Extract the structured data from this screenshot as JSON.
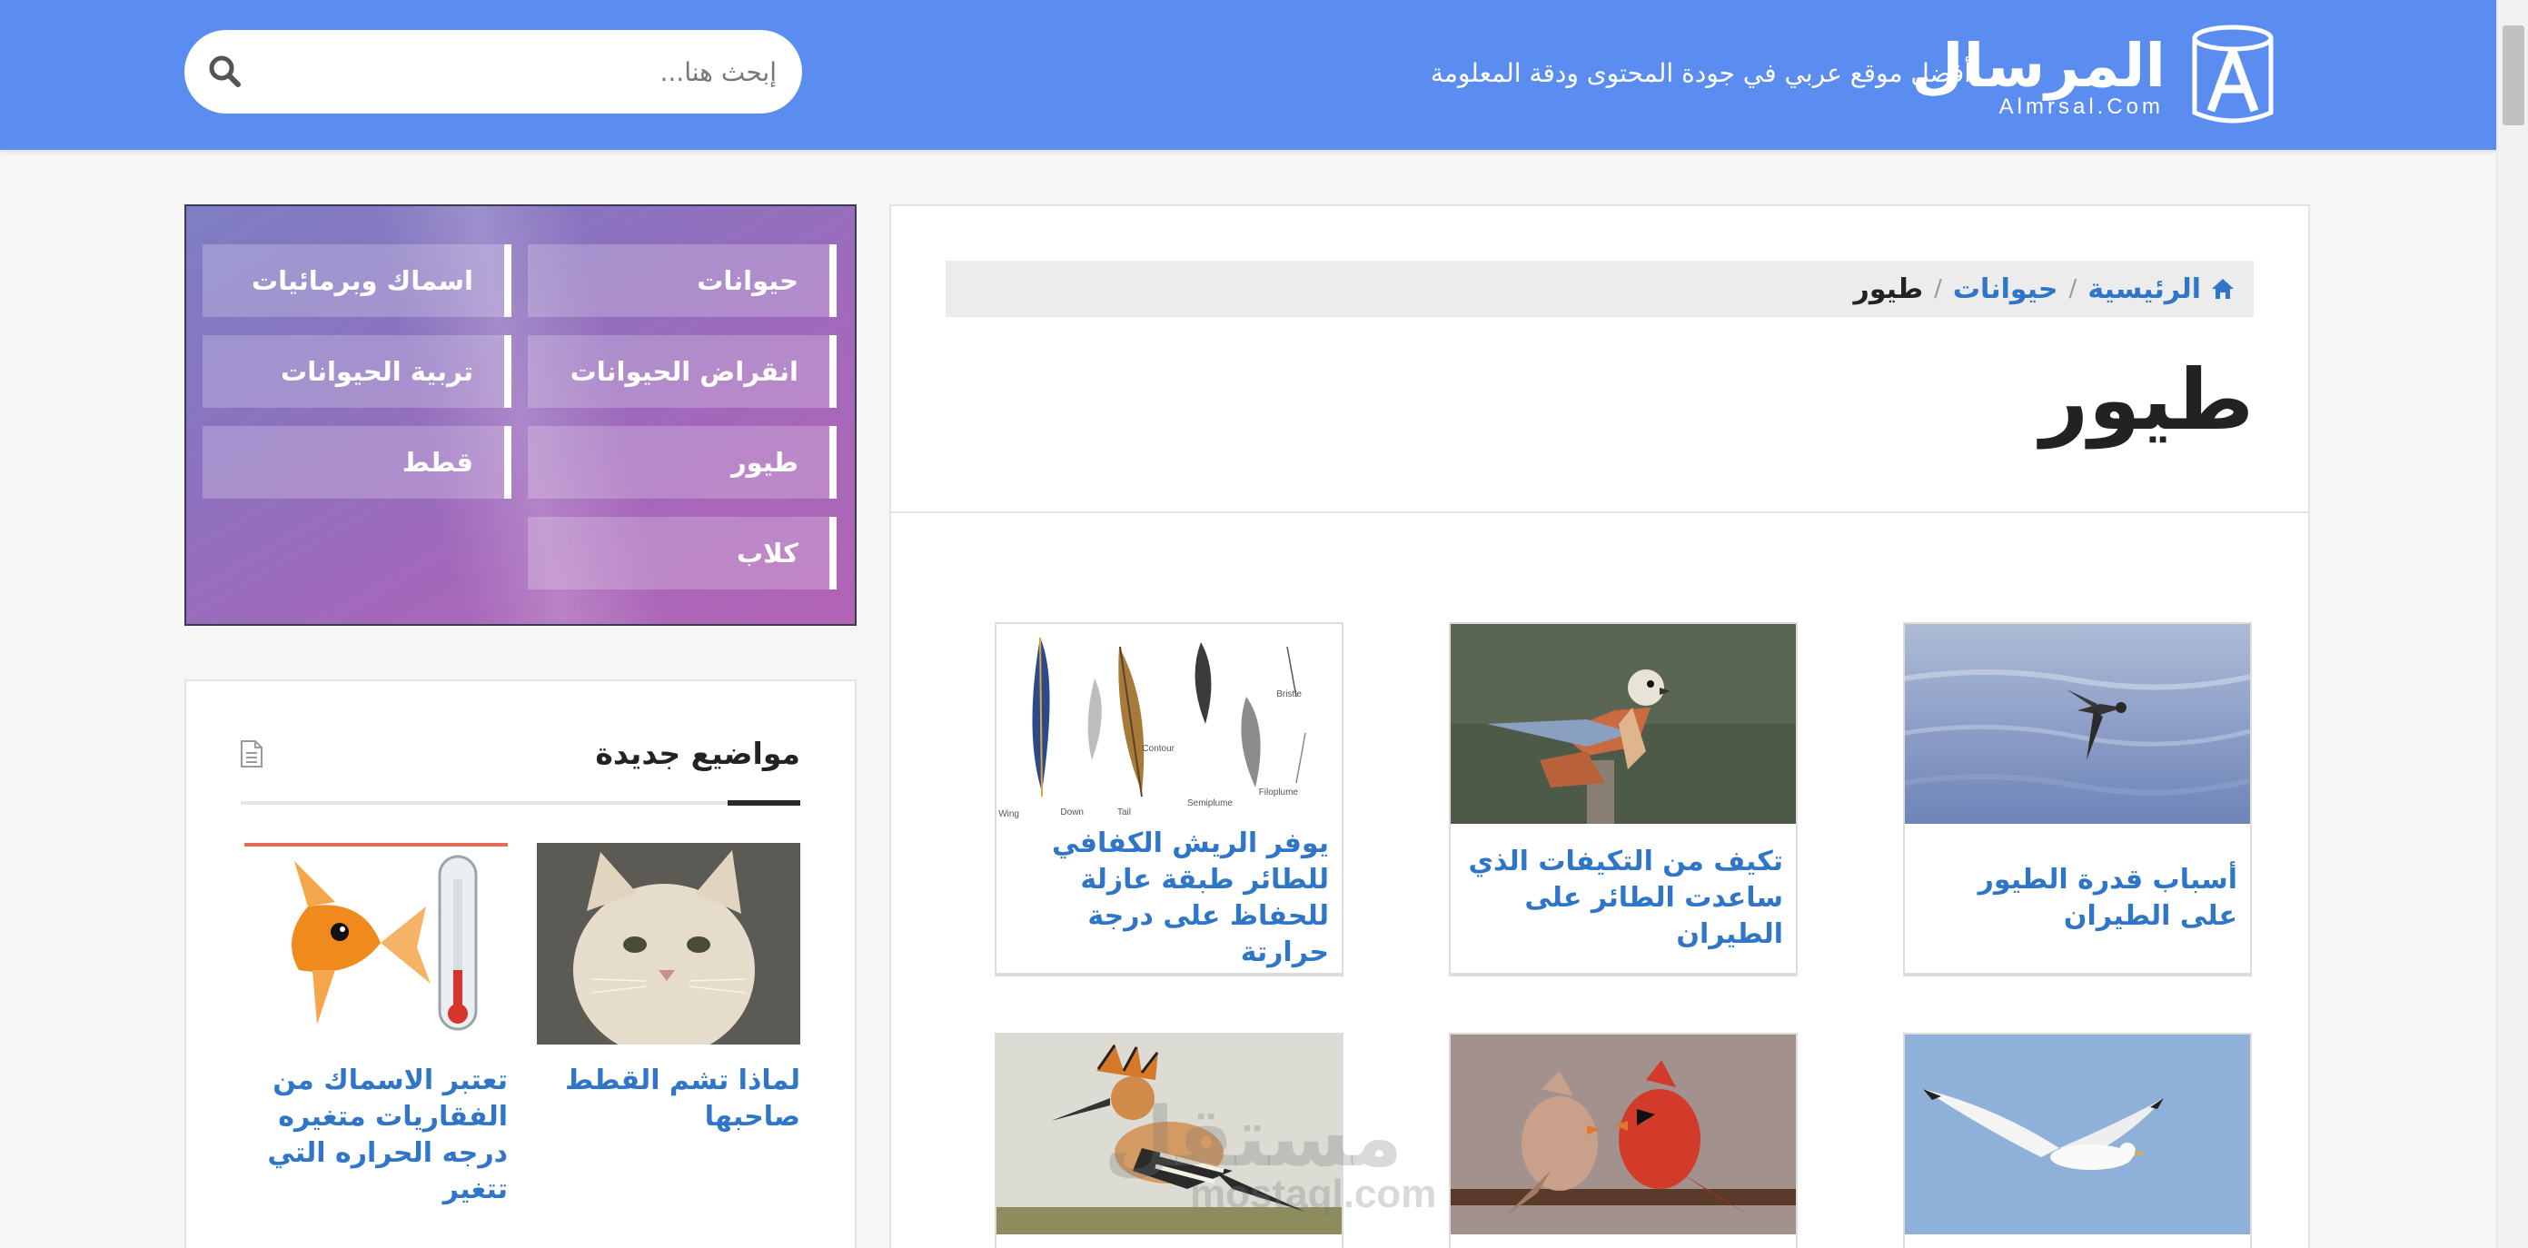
{
  "header": {
    "logo_name": "المرسال",
    "logo_sub": "Almrsal.Com",
    "tagline": "أفضل موقع عربي في جودة المحتوى ودقة المعلومة",
    "search_placeholder": "إبحث هنا..."
  },
  "breadcrumb": {
    "home": "الرئيسية",
    "sep": "/",
    "parent": "حيوانات",
    "current": "طيور"
  },
  "page_title": "طيور",
  "articles": [
    {
      "title": "أسباب قدرة الطيور على الطيران",
      "image": "bird-over-water"
    },
    {
      "title": "تكيف من التكيفات الذي ساعدت الطائر على الطيران",
      "image": "kestrel-on-post"
    },
    {
      "title": "يوفر الريش الكفافي للطائر طبقة عازلة للحفاظ على درجة حرارتة",
      "image": "feather-types-diagram"
    },
    {
      "title": "",
      "image": "seagull-flying"
    },
    {
      "title": "",
      "image": "cardinals-pair"
    },
    {
      "title": "",
      "image": "hoopoe-bird"
    }
  ],
  "feather_labels": [
    "Bristle",
    "Wing",
    "Down",
    "Tail",
    "Contour",
    "Semiplume",
    "Filoplume"
  ],
  "categories": [
    {
      "label": "حيوانات"
    },
    {
      "label": "اسماك وبرمائيات"
    },
    {
      "label": "انقراض الحيوانات"
    },
    {
      "label": "تربية الحيوانات"
    },
    {
      "label": "طيور"
    },
    {
      "label": "قطط"
    },
    {
      "label": "كلاب"
    }
  ],
  "new_topics": {
    "heading": "مواضيع جديدة",
    "items": [
      {
        "title": "لماذا تشم القطط صاحبها",
        "image": "kitten"
      },
      {
        "title": "تعتبر الاسماك من الفقاريات متغيره درجه الحراره التي تتغير",
        "image": "goldfish-thermometer"
      }
    ]
  },
  "watermark": {
    "text": "مستقل",
    "sub": "mostaql.com"
  },
  "colors": {
    "header": "#5b8df0",
    "link": "#2f76c8",
    "category_gradient_start": "#7e7ec4",
    "category_gradient_end": "#b364b5"
  }
}
